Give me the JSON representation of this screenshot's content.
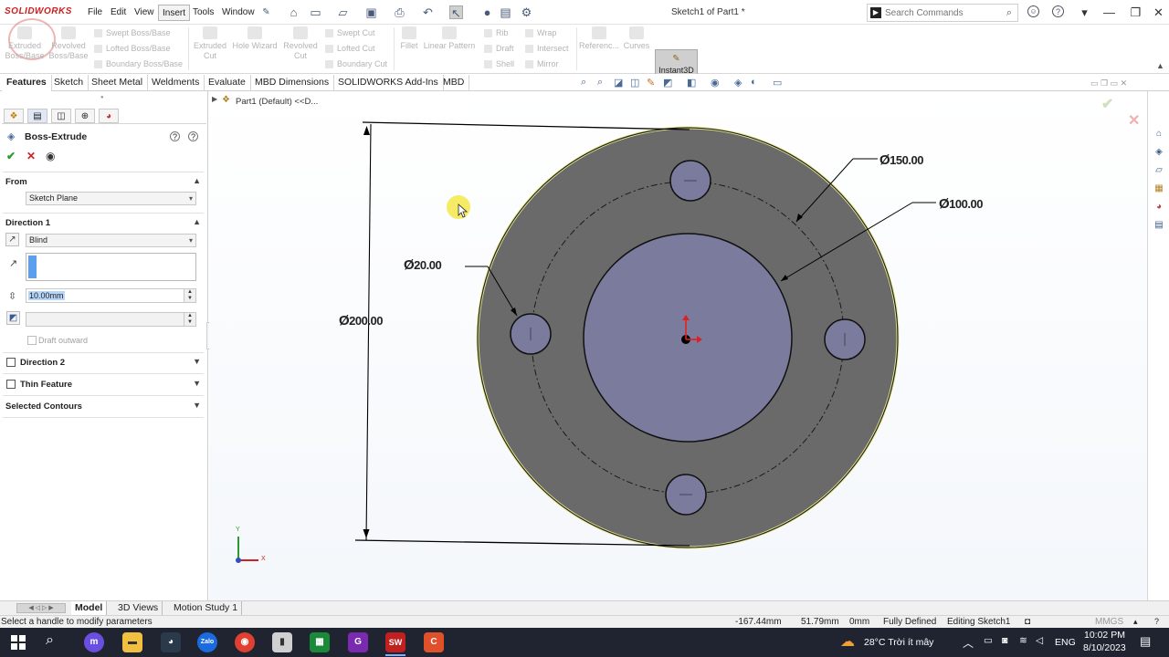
{
  "app": {
    "logo": "SOLIDWORKS",
    "document_title": "Sketch1 of Part1 *"
  },
  "menu": [
    "File",
    "Edit",
    "View",
    "Insert",
    "Tools",
    "Window"
  ],
  "search": {
    "placeholder": "Search Commands"
  },
  "command_manager": {
    "extruded_boss": "Extruded Boss/Base",
    "revolved_boss": "Revolved Boss/Base",
    "swept_boss": "Swept Boss/Base",
    "lofted_boss": "Lofted Boss/Base",
    "boundary_boss": "Boundary Boss/Base",
    "extruded_cut": "Extruded Cut",
    "hole_wizard": "Hole Wizard",
    "revolved_cut": "Revolved Cut",
    "swept_cut": "Swept Cut",
    "lofted_cut": "Lofted Cut",
    "boundary_cut": "Boundary Cut",
    "fillet": "Fillet",
    "linear_pattern": "Linear Pattern",
    "rib": "Rib",
    "draft": "Draft",
    "shell": "Shell",
    "wrap": "Wrap",
    "intersect": "Intersect",
    "mirror": "Mirror",
    "reference": "Referenc...",
    "curves": "Curves",
    "instant3d": "Instant3D"
  },
  "tabs": [
    "Features",
    "Sketch",
    "Sheet Metal",
    "Weldments",
    "Evaluate",
    "MBD Dimensions",
    "SOLIDWORKS Add-Ins",
    "MBD"
  ],
  "property_manager": {
    "title": "Boss-Extrude",
    "from_label": "From",
    "from_value": "Sketch Plane",
    "direction1_label": "Direction 1",
    "end_condition": "Blind",
    "depth": "10.00mm",
    "draft_outward": "Draft outward",
    "direction2_label": "Direction 2",
    "thin_feature_label": "Thin Feature",
    "selected_contours_label": "Selected Contours"
  },
  "feature_tree": {
    "part_label": "Part1 (Default) <<D..."
  },
  "drawing": {
    "dim_outer": "200.00",
    "dim_pcd": "150.00",
    "dim_inner": "100.00",
    "dim_hole": "20.00",
    "diameter_symbol": "Ø"
  },
  "triad": {
    "y": "Y",
    "x": "X"
  },
  "bottom_tabs": [
    "Model",
    "3D Views",
    "Motion Study 1"
  ],
  "status": {
    "message": "Select a handle to modify parameters",
    "x_coord": "-167.44mm",
    "y_coord": "51.79mm",
    "z_coord": "0mm",
    "sketch_state": "Fully Defined",
    "editing": "Editing Sketch1",
    "units": "MMGS"
  },
  "taskbar": {
    "weather": "28°C  Trời ít mây",
    "language": "ENG",
    "time": "10:02 PM",
    "date": "8/10/2023"
  },
  "colors": {
    "accent_red": "#d21d1d",
    "part_face": "#6b6b6b",
    "inner_face": "#7b7b9d",
    "taskbar": "#1f2430"
  }
}
